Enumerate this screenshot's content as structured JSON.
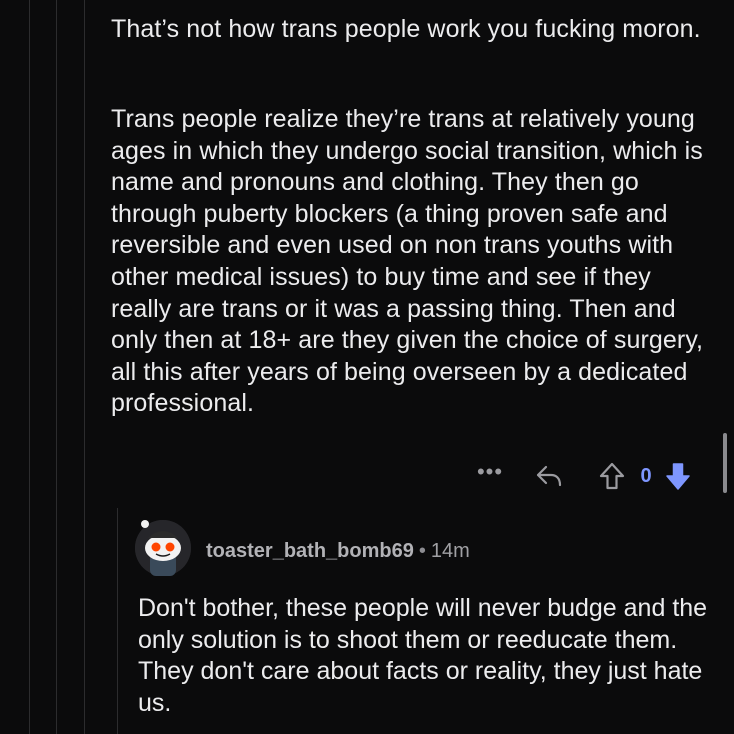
{
  "parent_comment": {
    "paragraphs": [
      "That’s not how trans people work you fucking moron.",
      "Trans people realize they’re trans at relatively young ages in which they undergo social transition, which is name and pronouns and clothing. They then go through puberty blockers (a thing proven safe and reversible and even used on non trans youths with other medical issues) to buy time and see if they really are trans or it was a passing thing. Then and only then at 18+ are they given the choice of surgery, all this after years of being overseen by a dedicated professional."
    ],
    "actions": {
      "more_icon": "ellipsis-icon",
      "more_glyph": "•••",
      "reply_icon": "reply-arrow-icon",
      "upvote_icon": "upvote-arrow-icon",
      "vote_count": "0",
      "downvote_icon": "downvote-arrow-icon"
    }
  },
  "reply_comment": {
    "username": "toaster_bath_bomb69",
    "separator": "•",
    "timestamp": "14m",
    "body": "Don't bother, these people will never budge and the only solution is to shoot them or reeducate them. They don't care about facts or reality, they just hate us."
  },
  "colors": {
    "background": "#0b0b0c",
    "text": "#ececee",
    "muted": "#a7a7ab",
    "vote_accent": "#7e96ff"
  }
}
